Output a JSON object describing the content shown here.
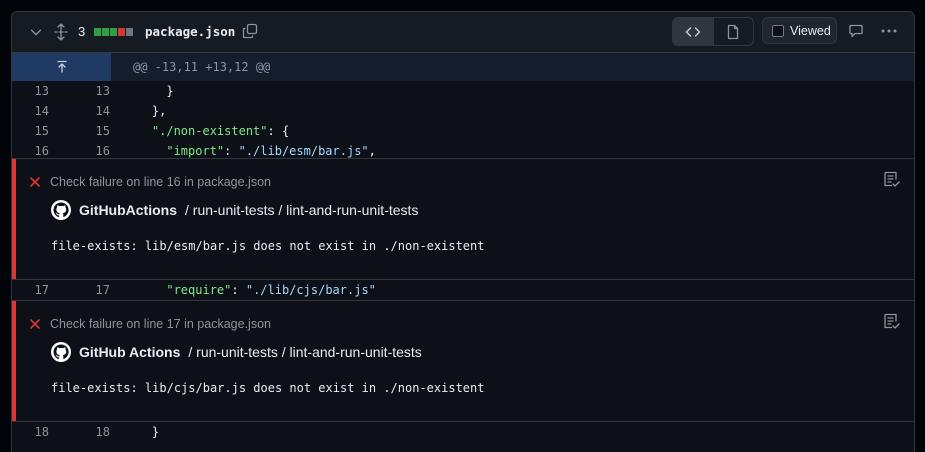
{
  "header": {
    "changes_count": "3",
    "diffstat_colors": [
      "#2ea043",
      "#2ea043",
      "#2ea043",
      "#da3633",
      "#6e7681"
    ],
    "filename": "package.json",
    "viewed_label": "Viewed",
    "icons": [
      "chevron-down-icon",
      "unfold-icon",
      "copy-icon",
      "code-icon",
      "file-icon",
      "comment-icon",
      "kebab-horizontal-icon"
    ]
  },
  "hunk": {
    "header": "@@ -13,11 +13,12 @@"
  },
  "lines": [
    {
      "old": "13",
      "new": "13",
      "code": "      }"
    },
    {
      "old": "14",
      "new": "14",
      "code": "    },"
    },
    {
      "old": "15",
      "new": "15",
      "code": "    \"./non-existent\": {"
    },
    {
      "old": "16",
      "new": "16",
      "code": "      \"import\": \"./lib/esm/bar.js\","
    },
    {
      "old": "17",
      "new": "17",
      "code": "      \"require\": \"./lib/cjs/bar.js\""
    },
    {
      "old": "18",
      "new": "18",
      "code": "    }"
    }
  ],
  "annotations": [
    {
      "title": "Check failure on line 16 in package.json",
      "app": "GitHubActions",
      "path": "/ run-unit-tests / lint-and-run-unit-tests",
      "message": "file-exists: lib/esm/bar.js does not exist in ./non-existent"
    },
    {
      "title": "Check failure on line 17 in package.json",
      "app": "GitHub Actions",
      "path": "/ run-unit-tests / lint-and-run-unit-tests",
      "message": "file-exists: lib/cjs/bar.js does not exist in ./non-existent"
    }
  ],
  "colors": {
    "failure": "#da3633",
    "addition": "#2ea043",
    "string": "#a5d6ff",
    "key": "#7ee787"
  }
}
